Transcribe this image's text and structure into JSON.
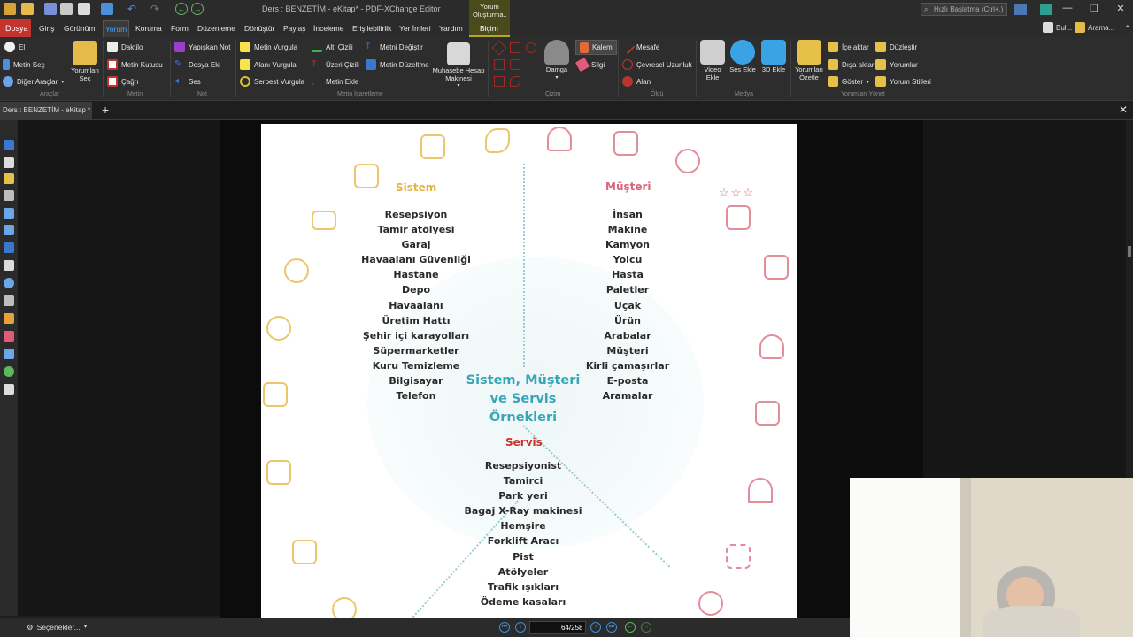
{
  "app": {
    "title": "Ders : BENZETİM - eKitap* - PDF-XChange Editor",
    "quick_launch_placeholder": "Hızlı Başlatma (Ctrl+.)",
    "find_label": "Bul...",
    "search_label": "Arama..."
  },
  "menu": {
    "file": "Dosya",
    "tabs": [
      "Giriş",
      "Görünüm",
      "Yorum",
      "Koruma",
      "Form",
      "Düzenleme",
      "Dönüştür",
      "Paylaş",
      "İnceleme",
      "Erişilebilirlik",
      "Yer İmleri",
      "Yardım"
    ],
    "context_group": "Yorum Oluşturma..",
    "context_tab": "Biçim"
  },
  "ribbon": {
    "tools": {
      "hand": "El",
      "select_text": "Metin Seç",
      "other_tools": "Diğer Araçlar",
      "select_comments": "Yorumları Seç",
      "group": "Araçlar"
    },
    "text": {
      "typewriter": "Daktilo",
      "textbox": "Metin Kutusu",
      "callout": "Çağrı",
      "group": "Metin"
    },
    "note": {
      "sticky": "Yapışkan Not",
      "file_attach": "Dosya Eki",
      "sound": "Ses",
      "group": "Not"
    },
    "markup": {
      "highlight": "Metin Vurgula",
      "area_highlight": "Alanı Vurgula",
      "free_highlight": "Serbest Vurgula",
      "underline": "Altı Çizili",
      "strikeout": "Üzeri Çizili",
      "insert_text": "Metin Ekle",
      "replace_text": "Metni Değiştir",
      "text_edit": "Metin Düzeltme",
      "group": "Metin İşaretleme"
    },
    "calculator": "Muhasebe Hesap Makinesi",
    "drawing": {
      "stamp": "Damga",
      "pencil": "Kalem",
      "eraser": "Silgi",
      "group": "Çizim"
    },
    "measure": {
      "distance": "Mesafe",
      "perimeter": "Çevresel Uzunluk",
      "area": "Alan",
      "group": "Ölçü"
    },
    "media": {
      "video": "Video Ekle",
      "sound": "Ses Ekle",
      "threed": "3D Ekle",
      "group": "Medya"
    },
    "manage": {
      "summarize": "Yorumları Özetle",
      "import": "İçe aktar",
      "export": "Dışa aktar",
      "show": "Göster",
      "flatten": "Düzleştir",
      "comments": "Yorumlar",
      "styles": "Yorum Stilleri",
      "group": "Yorumları Yönet"
    }
  },
  "doc_tab": "Ders : BENZETİM - eKitap *",
  "page": {
    "system_title": "Sistem",
    "system_items": [
      "Resepsiyon",
      "Tamir atölyesi",
      "Garaj",
      "Havaalanı Güvenliği",
      "Hastane",
      "Depo",
      "Havaalanı",
      "Üretim Hattı",
      "Şehir içi karayolları",
      "Süpermarketler",
      "Kuru Temizleme",
      "Bilgisayar",
      "Telefon"
    ],
    "customer_title": "Müşteri",
    "customer_items": [
      "İnsan",
      "Makine",
      "Kamyon",
      "Yolcu",
      "Hasta",
      "Paletler",
      "Uçak",
      "Ürün",
      "Arabalar",
      "Müşteri",
      "Kirli çamaşırlar",
      "E-posta",
      "Aramalar"
    ],
    "center_title": "Sistem, Müşteri ve Servis Örnekleri",
    "service_title": "Servis",
    "service_items": [
      "Resepsiyonist",
      "Tamirci",
      "Park yeri",
      "Bagaj X-Ray makinesi",
      "Hemşire",
      "Forklift Aracı",
      "Pist",
      "Atölyeler",
      "Trafik ışıkları",
      "Ödeme kasaları"
    ],
    "colors": {
      "system": "#e6b33b",
      "customer": "#d9667b",
      "center": "#37a6b8"
    }
  },
  "status": {
    "options": "Seçenekler...",
    "current_page": "64",
    "total_pages": "/258"
  }
}
